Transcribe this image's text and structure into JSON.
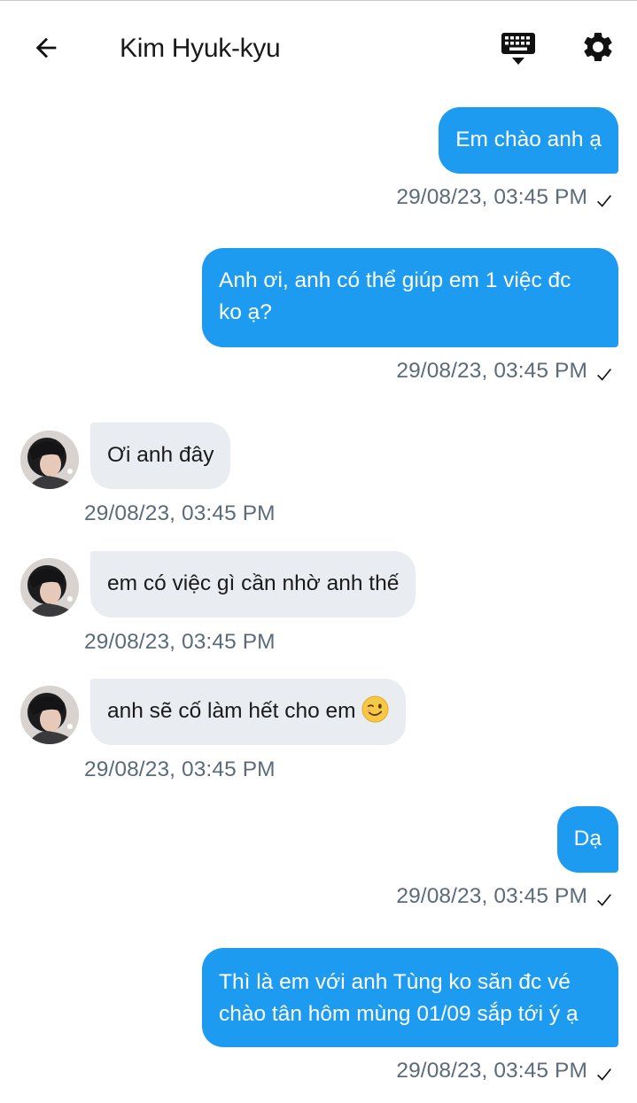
{
  "header": {
    "title": "Kim Hyuk-kyu",
    "back_icon": "arrow-left-icon",
    "keyboard_icon": "keyboard-hide-icon",
    "settings_icon": "gear-icon"
  },
  "colors": {
    "outgoing_bubble": "#1d9bf0",
    "incoming_bubble": "#e9edf1",
    "timestamp": "#5b6b7a"
  },
  "messages": [
    {
      "direction": "out",
      "text": "Em chào anh ạ",
      "time": "29/08/23, 03:45 PM",
      "status": "sent"
    },
    {
      "direction": "out",
      "text_lines": [
        "Anh ơi, anh có thể giúp em 1 việc đc",
        "ko ạ?"
      ],
      "time": "29/08/23, 03:45 PM",
      "status": "sent"
    },
    {
      "direction": "in",
      "text": "Ơi anh đây",
      "time": "29/08/23, 03:45 PM"
    },
    {
      "direction": "in",
      "text": "em có việc gì cần nhờ anh thế",
      "time": "29/08/23, 03:45 PM"
    },
    {
      "direction": "in",
      "text": "anh sẽ cố làm hết cho em",
      "emoji": "winking-face-emoji",
      "time": "29/08/23, 03:45 PM"
    },
    {
      "direction": "out",
      "text": "Dạ",
      "time": "29/08/23, 03:45 PM",
      "status": "sent"
    },
    {
      "direction": "out",
      "text_lines": [
        "Thì là em với anh Tùng ko săn đc vé",
        "chào tân hôm mùng 01/09 sắp tới ý ạ"
      ],
      "time": "29/08/23, 03:45 PM",
      "status": "sent"
    }
  ]
}
